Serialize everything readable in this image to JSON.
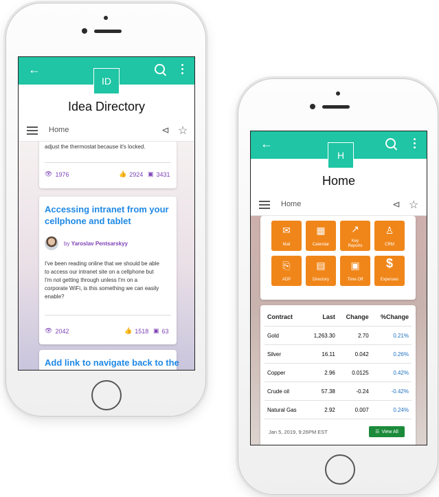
{
  "phone_left": {
    "badge": "ID",
    "title": "Idea Directory",
    "breadcrumb": "Home",
    "card1": {
      "text": "adjust the thermostat because it's locked.",
      "views": "1976",
      "likes": "2924",
      "comments": "3431"
    },
    "card2": {
      "title_line1": "Accessing intranet from your",
      "title_line2": "cellphone and tablet",
      "author_prefix": "by",
      "author": "Yaroslav Pentsarskyy",
      "body": [
        "I've been reading online that we should be able",
        "to access our intranet site on a cellphone but",
        "I'm not getting through unless I'm on a",
        "corporate WiFi, is this something we can easily",
        "enable?"
      ],
      "views": "2042",
      "likes": "1518",
      "comments": "63"
    },
    "card3": {
      "title": "Add link to navigate back to the"
    }
  },
  "phone_right": {
    "badge": "H",
    "title": "Home",
    "breadcrumb": "Home",
    "tiles": [
      {
        "label": "Mail",
        "icon": "mail-icon"
      },
      {
        "label": "Calendar",
        "icon": "calendar-icon"
      },
      {
        "label": "Key Reports",
        "icon": "chart-icon"
      },
      {
        "label": "CRM",
        "icon": "person-icon"
      },
      {
        "label": "ADP",
        "icon": "pdf-icon"
      },
      {
        "label": "Directory",
        "icon": "contact-card-icon"
      },
      {
        "label": "Time Off",
        "icon": "briefcase-icon"
      },
      {
        "label": "Expenses",
        "icon": "dollar-icon"
      }
    ],
    "market": {
      "headers": [
        "Contract",
        "Last",
        "Change",
        "%Change"
      ],
      "rows": [
        [
          "Gold",
          "1,263.30",
          "2.70",
          "0.21%"
        ],
        [
          "Silver",
          "16.11",
          "0.042",
          "0.26%"
        ],
        [
          "Copper",
          "2.96",
          "0.0125",
          "0.42%"
        ],
        [
          "Crude oil",
          "57.38",
          "-0.24",
          "-0.42%"
        ],
        [
          "Natural Gas",
          "2.92",
          "0.007",
          "0.24%"
        ]
      ],
      "timestamp": "Jan 5, 2019, 9:26PM EST",
      "view_all": "View All"
    }
  },
  "colors": {
    "teal": "#1fc5a4",
    "orange": "#f0861a",
    "purple": "#7b3fb5",
    "link_blue": "#1e88e5",
    "green": "#1b8a3a"
  }
}
